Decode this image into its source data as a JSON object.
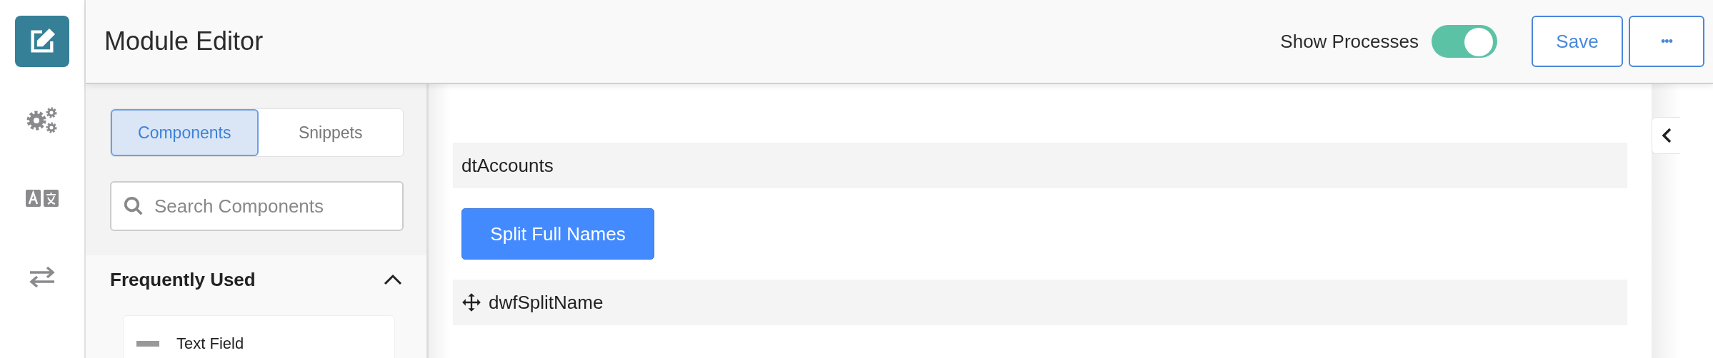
{
  "rail": {
    "items": [
      {
        "kind": "edit",
        "selected": true
      },
      {
        "kind": "gears",
        "selected": false
      },
      {
        "kind": "translate",
        "selected": false
      },
      {
        "kind": "transfer",
        "selected": false
      }
    ]
  },
  "header": {
    "title": "Module Editor",
    "show_processes": {
      "label": "Show Processes",
      "on": true
    },
    "save": "Save",
    "more": "•••"
  },
  "panel": {
    "tabs": [
      {
        "label": "Components",
        "selected": true
      },
      {
        "label": "Snippets",
        "selected": false
      }
    ],
    "search": {
      "placeholder": "Search Components"
    },
    "section": {
      "title": "Frequently Used",
      "expanded": true,
      "items": [
        {
          "label": "Text Field"
        }
      ]
    }
  },
  "canvas": {
    "items": [
      {
        "kind": "container",
        "label": "dtAccounts",
        "movable": false
      },
      {
        "kind": "button",
        "label": "Split Full Names"
      },
      {
        "kind": "container",
        "label": "dwfSplitName",
        "movable": true
      }
    ]
  }
}
